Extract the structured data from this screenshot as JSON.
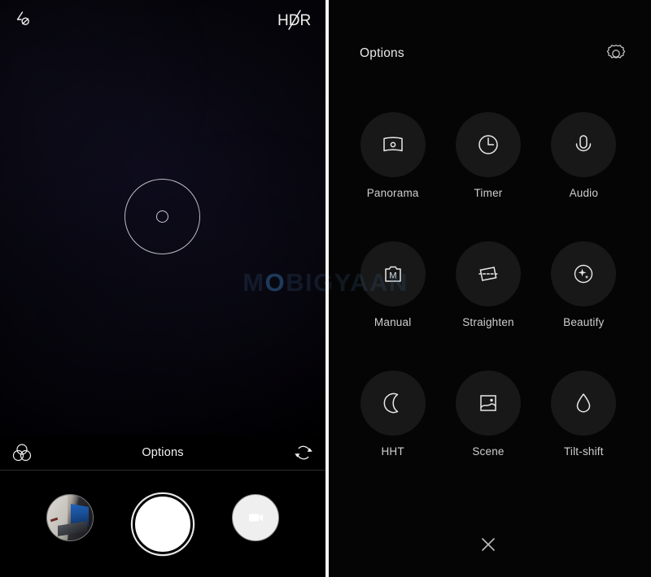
{
  "camera": {
    "status_bar": {
      "flash_icon": "flash-off-icon",
      "flash_label": "Flash off",
      "hdr_label": "HDR",
      "hdr_icon": "hdr-off-icon"
    },
    "focus_ring": {
      "name": "focus-ring"
    },
    "options_strip": {
      "filter_icon": "filter-icon",
      "options_label": "Options",
      "switch_camera_icon": "switch-camera-icon"
    },
    "shutter_row": {
      "gallery_label": "Gallery thumbnail",
      "shutter_label": "Shutter",
      "video_label": "Video record"
    },
    "watermark": {
      "prefix": "M",
      "highlight": "O",
      "suffix": "BIGYAAN",
      "full": "MOBIGYAAN"
    }
  },
  "options_panel": {
    "title": "Options",
    "settings_icon": "gear-icon",
    "close_icon": "close-icon",
    "modes": [
      {
        "label": "Panorama",
        "icon": "panorama-icon"
      },
      {
        "label": "Timer",
        "icon": "clock-icon"
      },
      {
        "label": "Audio",
        "icon": "microphone-icon"
      },
      {
        "label": "Manual",
        "icon": "manual-camera-icon"
      },
      {
        "label": "Straighten",
        "icon": "straighten-icon"
      },
      {
        "label": "Beautify",
        "icon": "sparkle-icon"
      },
      {
        "label": "HHT",
        "icon": "moon-icon"
      },
      {
        "label": "Scene",
        "icon": "landscape-icon"
      },
      {
        "label": "Tilt-shift",
        "icon": "water-drop-icon"
      }
    ]
  },
  "colors": {
    "background": "#000000",
    "circle_fill": "#181818",
    "icon_stroke": "#e9e9e9",
    "label_text": "#cfcfcf",
    "divider": "#f4f4f4",
    "watermark": "#3a6087"
  }
}
